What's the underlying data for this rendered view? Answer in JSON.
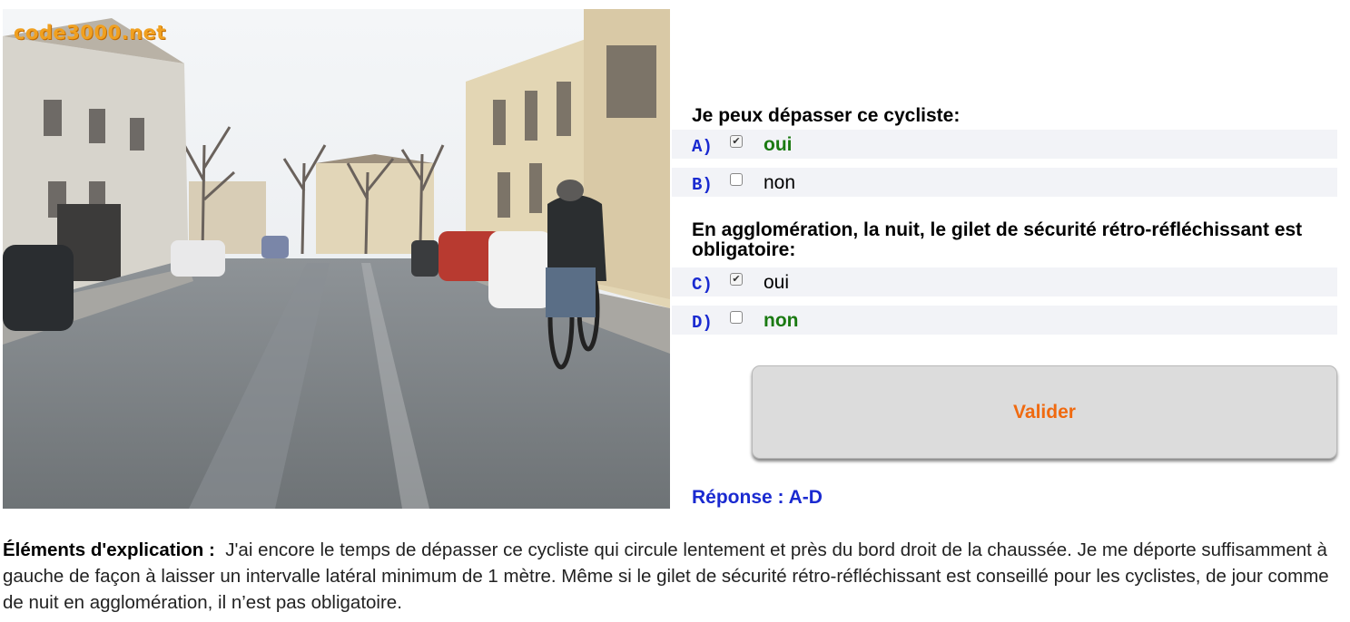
{
  "image": {
    "watermark": "code3000.net",
    "description_icon": "street-scene-photo"
  },
  "questions": [
    {
      "text": "Je peux dépasser ce cycliste:",
      "answers": [
        {
          "letter": "A)",
          "text": "oui",
          "checked": true,
          "correct": true
        },
        {
          "letter": "B)",
          "text": "non",
          "checked": false,
          "correct": false
        }
      ]
    },
    {
      "text": "En agglomération, la nuit, le gilet de sécurité rétro-réfléchissant est obligatoire:",
      "answers": [
        {
          "letter": "C)",
          "text": "oui",
          "checked": true,
          "correct": false
        },
        {
          "letter": "D)",
          "text": "non",
          "checked": false,
          "correct": true
        }
      ]
    }
  ],
  "submit_label": "Valider",
  "answer_line": "Réponse : A-D",
  "explanation": {
    "label": "Éléments d'explication :",
    "text": "J'ai encore le temps de dépasser ce cycliste qui circule lentement et près du bord droit de la chaussée. Je me déporte suffisamment à gauche de façon à laisser un intervalle latéral minimum de 1 mètre. Même si le gilet de sécurité rétro-réfléchissant est conseillé pour les cyclistes, de jour comme de nuit en agglomération, il n’est pas obligatoire."
  },
  "colors": {
    "correct_answer": "#1b7a12",
    "letter_blue": "#1a2ad0",
    "submit_text": "#f06a10",
    "answer_row_bg": "#f2f3f7"
  }
}
